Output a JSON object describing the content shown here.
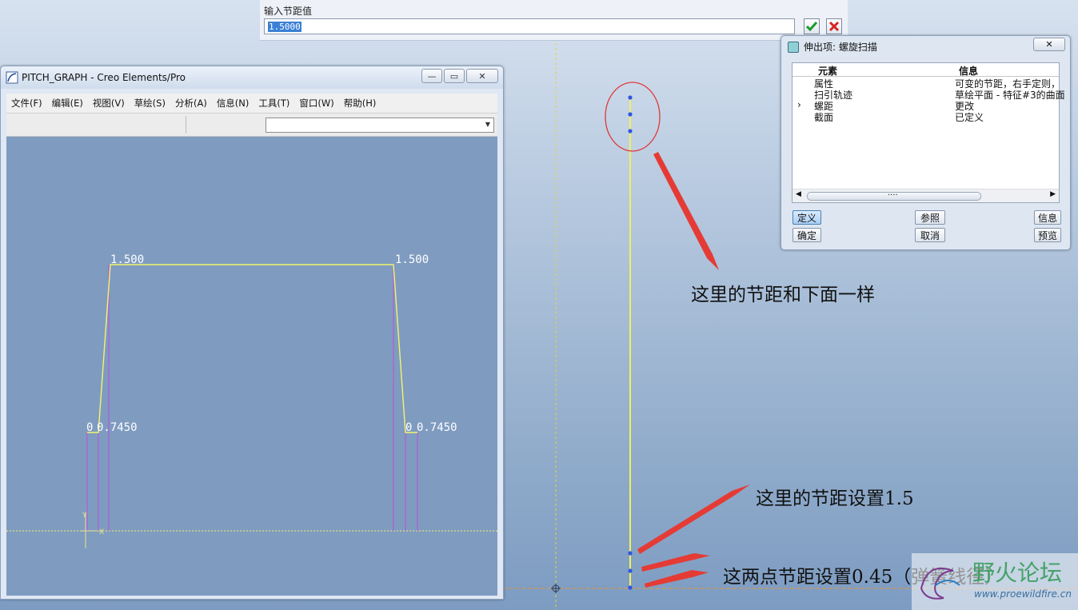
{
  "pitch_prompt": {
    "label": "输入节距值",
    "value": "1.5000",
    "accept_icon": "check-icon",
    "cancel_icon": "close-icon"
  },
  "pitch_graph_window": {
    "title": "PITCH_GRAPH - Creo Elements/Pro",
    "menu": [
      "文件(F)",
      "编辑(E)",
      "视图(V)",
      "草绘(S)",
      "分析(A)",
      "信息(N)",
      "工具(T)",
      "窗口(W)",
      "帮助(H)"
    ],
    "dim_left_top": "1.500",
    "dim_right_top": "1.500",
    "dim_left_bottom_a": "0",
    "dim_left_bottom_b": "0.7450",
    "dim_right_bottom_a": "0",
    "dim_right_bottom_b": "0.7450",
    "axis_y": "Y",
    "axis_x": "X"
  },
  "feature_dialog": {
    "title": "伸出项: 螺旋扫描",
    "col_element": "元素",
    "col_info": "信息",
    "rows": [
      {
        "marker": "",
        "element": "属性",
        "info": "可变的节距，右手定则，"
      },
      {
        "marker": "",
        "element": "扫引轨迹",
        "info": "草绘平面 - 特征#3的曲面"
      },
      {
        "marker": "›",
        "element": "螺距",
        "info": "更改"
      },
      {
        "marker": "",
        "element": "截面",
        "info": "已定义"
      }
    ],
    "scroll_grip": "....",
    "buttons": {
      "define": "定义",
      "refs": "参照",
      "info": "信息",
      "ok": "确定",
      "cancel": "取消",
      "preview": "预览"
    }
  },
  "annotations": {
    "top": "这里的节距和下面一样",
    "middle": "这里的节距设置1.5",
    "bottom": "这两点节距设置0.45（弹簧线径）"
  },
  "watermark": {
    "brand": "野火论坛",
    "url": "www.proewildfire.cn"
  },
  "colors": {
    "graph_line": "#f4f46a",
    "graph_dim_line": "#b15cd8",
    "helix_axis": "#f2ef5c",
    "annotation_arrow": "#e53b35",
    "highlight_circle": "#e0393a"
  }
}
